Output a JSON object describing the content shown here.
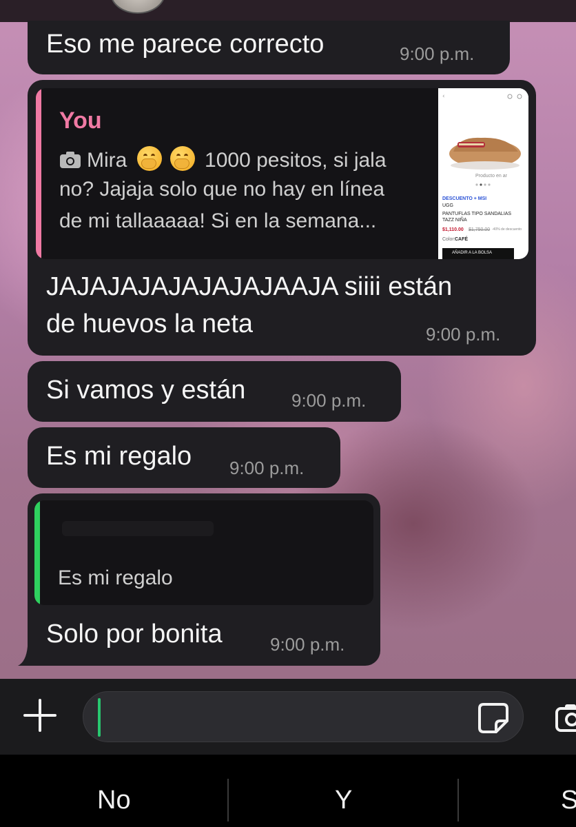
{
  "messages": [
    {
      "text": "Eso me parece correcto",
      "time": "9:00 p.m."
    },
    {
      "reply_to": {
        "author": "You",
        "lines": [
          "Mira",
          "1000 pesitos, si jala",
          "no? Jajaja solo que no hay en línea",
          "de mi tallaaaaa! Si en la semana..."
        ],
        "attachment": "photo",
        "emojis": [
          "hand-over-mouth-emoji",
          "hand-over-mouth-emoji"
        ],
        "thumbnail": {
          "badge": "DESCUENTO + MSI",
          "brand": "UGG",
          "title": "PANTUFLAS TIPO SANDALIAS TAZZ NIÑA",
          "price": "$1,110.00",
          "old_price": "$1,750.00",
          "discount": "-40% de descuento",
          "color_label": "Color:",
          "color": "CAFÉ",
          "button": "AÑADIR A LA BOLSA",
          "product_label": "Producto en ar"
        },
        "accent_color": "#f07aa4"
      },
      "text_lines": [
        "JAJAJAJAJAJAJAJAAJA siiii están",
        "de huevos la neta"
      ],
      "time": "9:00 p.m."
    },
    {
      "text": "Si vamos y están",
      "time": "9:00 p.m."
    },
    {
      "text": "Es mi regalo",
      "time": "9:00 p.m."
    },
    {
      "reply_to": {
        "author": "",
        "line": "Es mi regalo",
        "accent_color": "#2fd15f"
      },
      "text": "Solo por bonita",
      "time": "9:00 p.m."
    }
  ],
  "composer": {
    "plus_icon": "plus-icon",
    "sticker_icon": "sticker-icon",
    "camera_icon": "camera-icon",
    "placeholder": ""
  },
  "keyboard": {
    "suggestions": [
      "No",
      "Y",
      "S"
    ]
  },
  "colors": {
    "bubble": "#1f1e22",
    "quote_bg": "#141316",
    "timestamp": "#9c9c9c",
    "cursor": "#28c76f"
  }
}
